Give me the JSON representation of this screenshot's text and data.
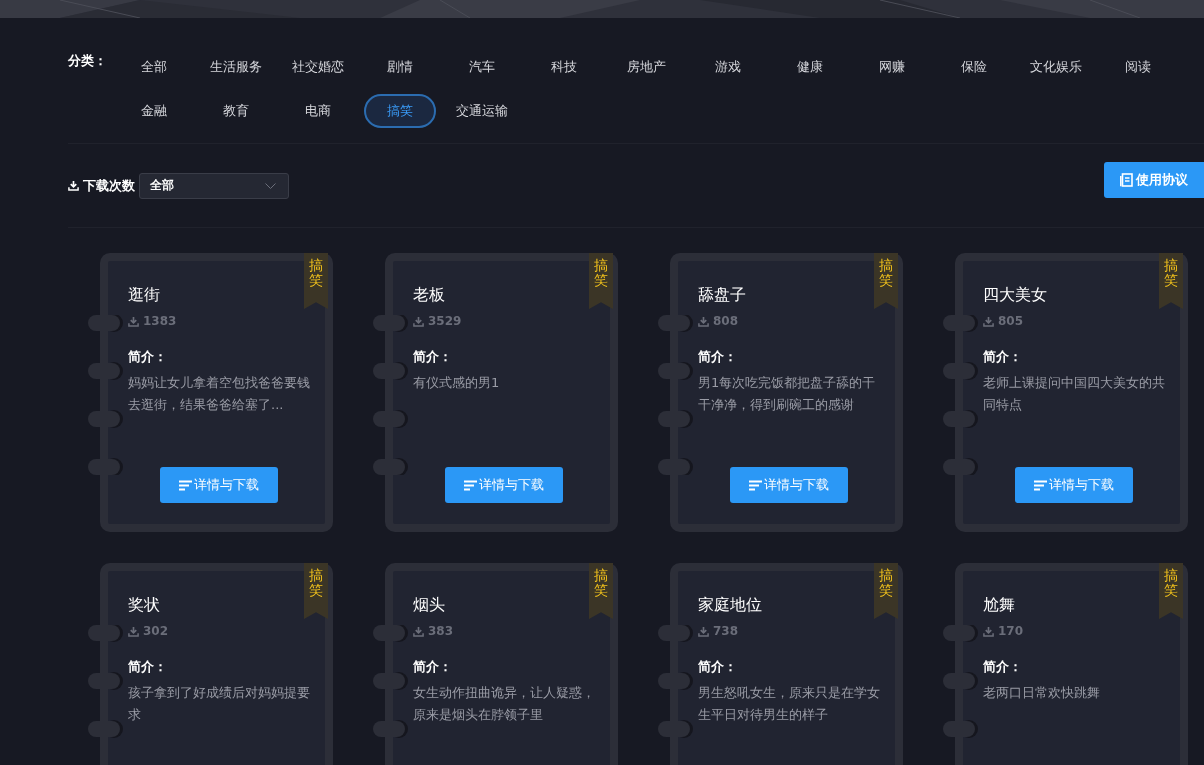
{
  "categories_label": "分类：",
  "categories": [
    {
      "label": "全部",
      "selected": false
    },
    {
      "label": "生活服务",
      "selected": false
    },
    {
      "label": "社交婚恋",
      "selected": false
    },
    {
      "label": "剧情",
      "selected": false
    },
    {
      "label": "汽车",
      "selected": false
    },
    {
      "label": "科技",
      "selected": false
    },
    {
      "label": "房地产",
      "selected": false
    },
    {
      "label": "游戏",
      "selected": false
    },
    {
      "label": "健康",
      "selected": false
    },
    {
      "label": "网赚",
      "selected": false
    },
    {
      "label": "保险",
      "selected": false
    },
    {
      "label": "文化娱乐",
      "selected": false
    },
    {
      "label": "阅读",
      "selected": false
    },
    {
      "label": "金融",
      "selected": false
    },
    {
      "label": "教育",
      "selected": false
    },
    {
      "label": "电商",
      "selected": false
    },
    {
      "label": "搞笑",
      "selected": true
    },
    {
      "label": "交通运输",
      "selected": false
    }
  ],
  "filter": {
    "label": "下载次数",
    "value": "全部"
  },
  "agreement_button": "使用协议",
  "cards": [
    {
      "title": "逛街",
      "downloads": "1383",
      "tag": "搞笑",
      "intro_label": "简介：",
      "description": "妈妈让女儿拿着空包找爸爸要钱去逛街，结果爸爸给塞了...",
      "button": "详情与下载"
    },
    {
      "title": "老板",
      "downloads": "3529",
      "tag": "搞笑",
      "intro_label": "简介：",
      "description": "有仪式感的男1",
      "button": "详情与下载"
    },
    {
      "title": "舔盘子",
      "downloads": "808",
      "tag": "搞笑",
      "intro_label": "简介：",
      "description": "男1每次吃完饭都把盘子舔的干干净净，得到刷碗工的感谢",
      "button": "详情与下载"
    },
    {
      "title": "四大美女",
      "downloads": "805",
      "tag": "搞笑",
      "intro_label": "简介：",
      "description": "老师上课提问中国四大美女的共同特点",
      "button": "详情与下载"
    },
    {
      "title": "奖状",
      "downloads": "302",
      "tag": "搞笑",
      "intro_label": "简介：",
      "description": "孩子拿到了好成绩后对妈妈提要求"
    },
    {
      "title": "烟头",
      "downloads": "383",
      "tag": "搞笑",
      "intro_label": "简介：",
      "description": "女生动作扭曲诡异，让人疑惑，原来是烟头在脖领子里"
    },
    {
      "title": "家庭地位",
      "downloads": "738",
      "tag": "搞笑",
      "intro_label": "简介：",
      "description": "男生怒吼女生，原来只是在学女生平日对待男生的样子"
    },
    {
      "title": "尬舞",
      "downloads": "170",
      "tag": "搞笑",
      "intro_label": "简介：",
      "description": "老两口日常欢快跳舞"
    }
  ]
}
